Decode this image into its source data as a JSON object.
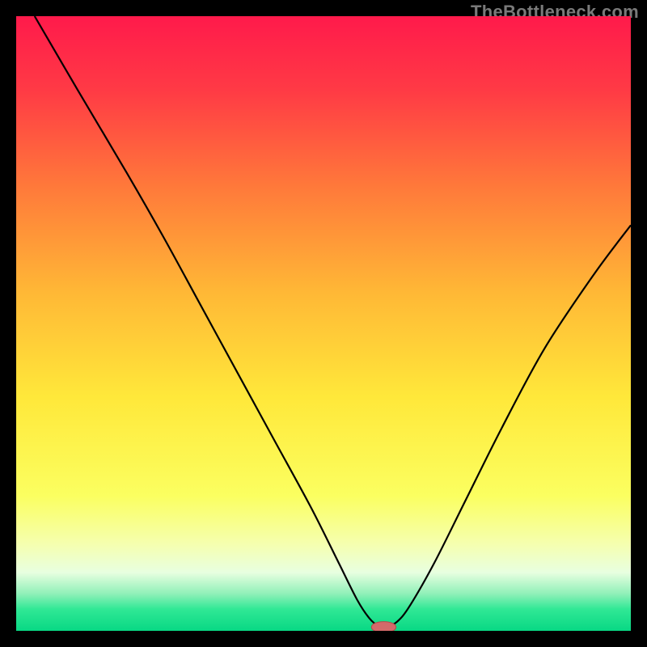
{
  "watermark": "TheBottleneck.com",
  "chart_data": {
    "type": "line",
    "title": "",
    "xlabel": "",
    "ylabel": "",
    "xlim": [
      0,
      100
    ],
    "ylim": [
      0,
      100
    ],
    "grid": false,
    "legend": false,
    "background_gradient": {
      "stops": [
        {
          "pos": 0.0,
          "color": "#ff1a4b"
        },
        {
          "pos": 0.12,
          "color": "#ff3a45"
        },
        {
          "pos": 0.28,
          "color": "#ff7a3a"
        },
        {
          "pos": 0.45,
          "color": "#ffb836"
        },
        {
          "pos": 0.62,
          "color": "#ffe83a"
        },
        {
          "pos": 0.78,
          "color": "#fbff60"
        },
        {
          "pos": 0.86,
          "color": "#f5ffb0"
        },
        {
          "pos": 0.905,
          "color": "#e8ffe0"
        },
        {
          "pos": 0.94,
          "color": "#8ff0b8"
        },
        {
          "pos": 0.965,
          "color": "#30e895"
        },
        {
          "pos": 1.0,
          "color": "#08d884"
        }
      ]
    },
    "series": [
      {
        "name": "bottleneck-curve",
        "color": "#000000",
        "width": 2.2,
        "x": [
          3,
          10,
          18,
          24,
          30,
          36,
          42,
          48,
          52.5,
          55.5,
          57.5,
          59,
          60.5,
          62,
          64,
          68,
          73,
          79,
          86,
          94,
          100
        ],
        "y": [
          100,
          88,
          74.5,
          64,
          53,
          42,
          31,
          20,
          11,
          5,
          2,
          0.8,
          0.8,
          1.5,
          4,
          11,
          21,
          33,
          46,
          58,
          66
        ]
      }
    ],
    "marker": {
      "name": "optimal-point",
      "x": 59.8,
      "y": 0.6,
      "rx": 2.0,
      "ry": 0.9,
      "fill": "#d36a6a",
      "stroke": "#b44a4a"
    }
  }
}
